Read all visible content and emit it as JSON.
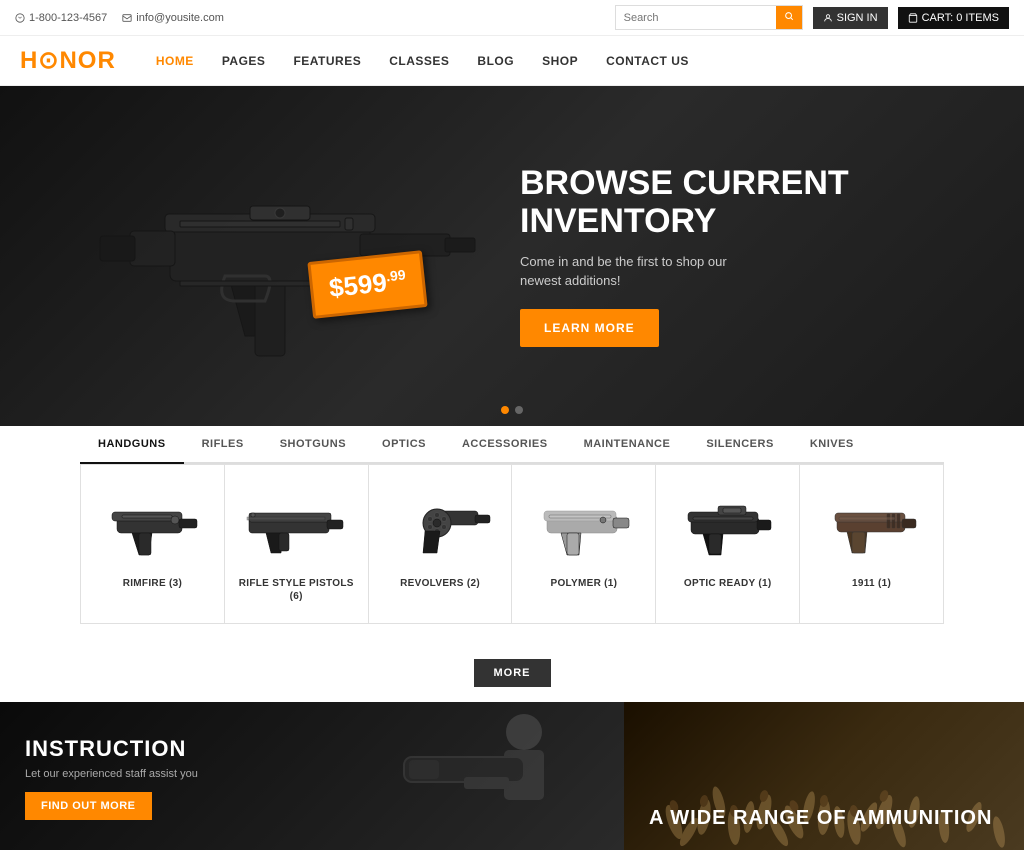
{
  "topbar": {
    "phone": "1-800-123-4567",
    "email": "info@yousite.com",
    "search_placeholder": "Search",
    "sign_in_label": "SIGN IN",
    "cart_label": "CART: 0 ITEMS"
  },
  "header": {
    "logo_part1": "H",
    "logo_crosshair": "O",
    "logo_part2": "N",
    "logo_accent": "O",
    "logo_part3": "R",
    "nav": [
      {
        "label": "HOME",
        "active": true
      },
      {
        "label": "PAGES",
        "active": false
      },
      {
        "label": "FEATURES",
        "active": false
      },
      {
        "label": "CLASSES",
        "active": false
      },
      {
        "label": "BLOG",
        "active": false
      },
      {
        "label": "SHOP",
        "active": false
      },
      {
        "label": "CONTACT US",
        "active": false
      }
    ]
  },
  "hero": {
    "title_line1": "BROWSE CURRENT",
    "title_line2": "INVENTORY",
    "subtitle": "Come in and be the first to shop our newest additions!",
    "price": "$599",
    "price_cents": ".99",
    "cta_label": "LEARN MORE",
    "dot_count": 2
  },
  "categories": [
    {
      "label": "HANDGUNS",
      "active": true
    },
    {
      "label": "RIFLES",
      "active": false
    },
    {
      "label": "SHOTGUNS",
      "active": false
    },
    {
      "label": "OPTICS",
      "active": false
    },
    {
      "label": "ACCESSORIES",
      "active": false
    },
    {
      "label": "MAINTENANCE",
      "active": false
    },
    {
      "label": "SILENCERS",
      "active": false
    },
    {
      "label": "KNIVES",
      "active": false
    }
  ],
  "products": [
    {
      "name": "RIMFIRE (3)",
      "type": "handgun-1"
    },
    {
      "name": "RIFLE STYLE PISTOLS (6)",
      "type": "handgun-2"
    },
    {
      "name": "REVOLVERS (2)",
      "type": "handgun-3"
    },
    {
      "name": "POLYMER (1)",
      "type": "handgun-4"
    },
    {
      "name": "OPTIC READY (1)",
      "type": "handgun-5"
    },
    {
      "name": "1911 (1)",
      "type": "handgun-6"
    }
  ],
  "more_button": "MORE",
  "promo": {
    "left": {
      "title": "INSTRUCTION",
      "subtitle": "Let our experienced staff assist you",
      "cta": "FIND OUT MORE"
    },
    "right": {
      "title": "A WIDE RANGE OF AMMUNITION"
    }
  }
}
